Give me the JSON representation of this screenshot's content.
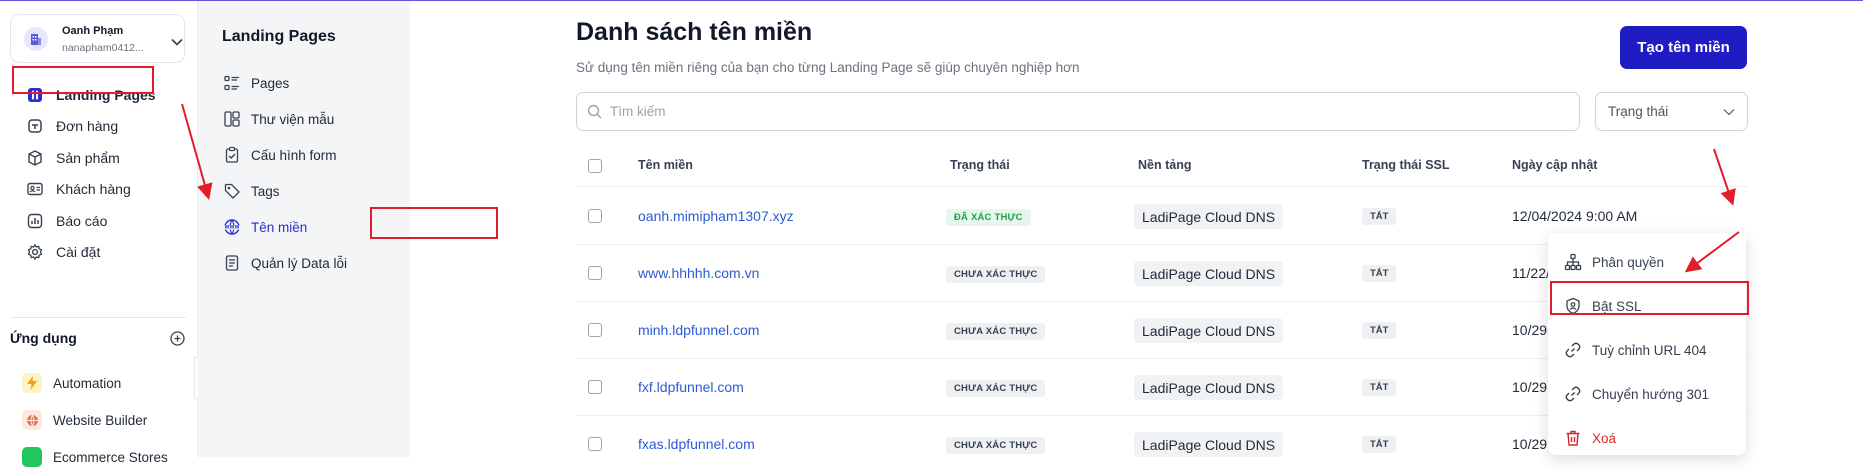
{
  "account": {
    "name": "Oanh Phạm",
    "email": "nanapham0412..."
  },
  "sidebar": {
    "items": [
      {
        "label": "Landing Pages",
        "icon": "landing-pages-icon",
        "active": true
      },
      {
        "label": "Đơn hàng",
        "icon": "order-icon"
      },
      {
        "label": "Sản phẩm",
        "icon": "box-icon"
      },
      {
        "label": "Khách hàng",
        "icon": "contact-card-icon"
      },
      {
        "label": "Báo cáo",
        "icon": "chart-icon"
      },
      {
        "label": "Cài đặt",
        "icon": "gear-icon"
      }
    ],
    "apps_heading": "Ứng dụng",
    "apps": [
      {
        "label": "Automation",
        "icon": "lightning-icon",
        "color": "#f59e0b"
      },
      {
        "label": "Website Builder",
        "icon": "website-icon",
        "color": "#d97757"
      },
      {
        "label": "Ecommerce Stores",
        "icon": "store-icon",
        "color": "#22c55e"
      }
    ]
  },
  "subnav": {
    "title": "Landing Pages",
    "items": [
      {
        "label": "Pages",
        "icon": "list-icon"
      },
      {
        "label": "Thư viện mẫu",
        "icon": "template-icon"
      },
      {
        "label": "Cấu hình form",
        "icon": "clipboard-check-icon"
      },
      {
        "label": "Tags",
        "icon": "tag-icon"
      },
      {
        "label": "Tên miền",
        "icon": "www-globe-icon",
        "active": true
      },
      {
        "label": "Quản lý Data lỗi",
        "icon": "document-icon"
      }
    ]
  },
  "main": {
    "title": "Danh sách tên miền",
    "description": "Sử dụng tên miền riêng của bạn cho từng Landing Page sẽ giúp chuyên nghiệp hơn",
    "create_button": "Tạo tên miền",
    "search_placeholder": "Tìm kiếm",
    "status_filter": "Trạng thái",
    "columns": [
      "Tên miền",
      "Trạng thái",
      "Nền tảng",
      "Trạng thái SSL",
      "Ngày cập nhật"
    ],
    "rows": [
      {
        "domain": "oanh.mimipham1307.xyz",
        "status": "ĐÃ XÁC THỰC",
        "verified": true,
        "platform": "LadiPage Cloud DNS",
        "ssl": "TẮT",
        "updated": "12/04/2024 9:00 AM"
      },
      {
        "domain": "www.hhhhh.com.vn",
        "status": "CHƯA XÁC THỰC",
        "verified": false,
        "platform": "LadiPage Cloud DNS",
        "ssl": "TẮT",
        "updated": "11/22/"
      },
      {
        "domain": "minh.ldpfunnel.com",
        "status": "CHƯA XÁC THỰC",
        "verified": false,
        "platform": "LadiPage Cloud DNS",
        "ssl": "TẮT",
        "updated": "10/29"
      },
      {
        "domain": "fxf.ldpfunnel.com",
        "status": "CHƯA XÁC THỰC",
        "verified": false,
        "platform": "LadiPage Cloud DNS",
        "ssl": "TẮT",
        "updated": "10/29"
      },
      {
        "domain": "fxas.ldpfunnel.com",
        "status": "CHƯA XÁC THỰC",
        "verified": false,
        "platform": "LadiPage Cloud DNS",
        "ssl": "TẮT",
        "updated": "10/29"
      }
    ],
    "more_label": "..."
  },
  "menu": {
    "items": [
      {
        "label": "Phân quyền",
        "icon": "hierarchy-icon"
      },
      {
        "label": "Bật SSL",
        "icon": "shield-user-icon"
      },
      {
        "label": "Tuỳ chỉnh URL 404",
        "icon": "link-icon"
      },
      {
        "label": "Chuyển hướng 301",
        "icon": "link-icon"
      },
      {
        "label": "Xoá",
        "icon": "trash-icon",
        "danger": true
      }
    ]
  },
  "colors": {
    "accent": "#1f1cc4",
    "annotation": "#e11d2b",
    "link": "#2a5bd7",
    "verified": "#16a34a",
    "danger": "#dc2626"
  }
}
